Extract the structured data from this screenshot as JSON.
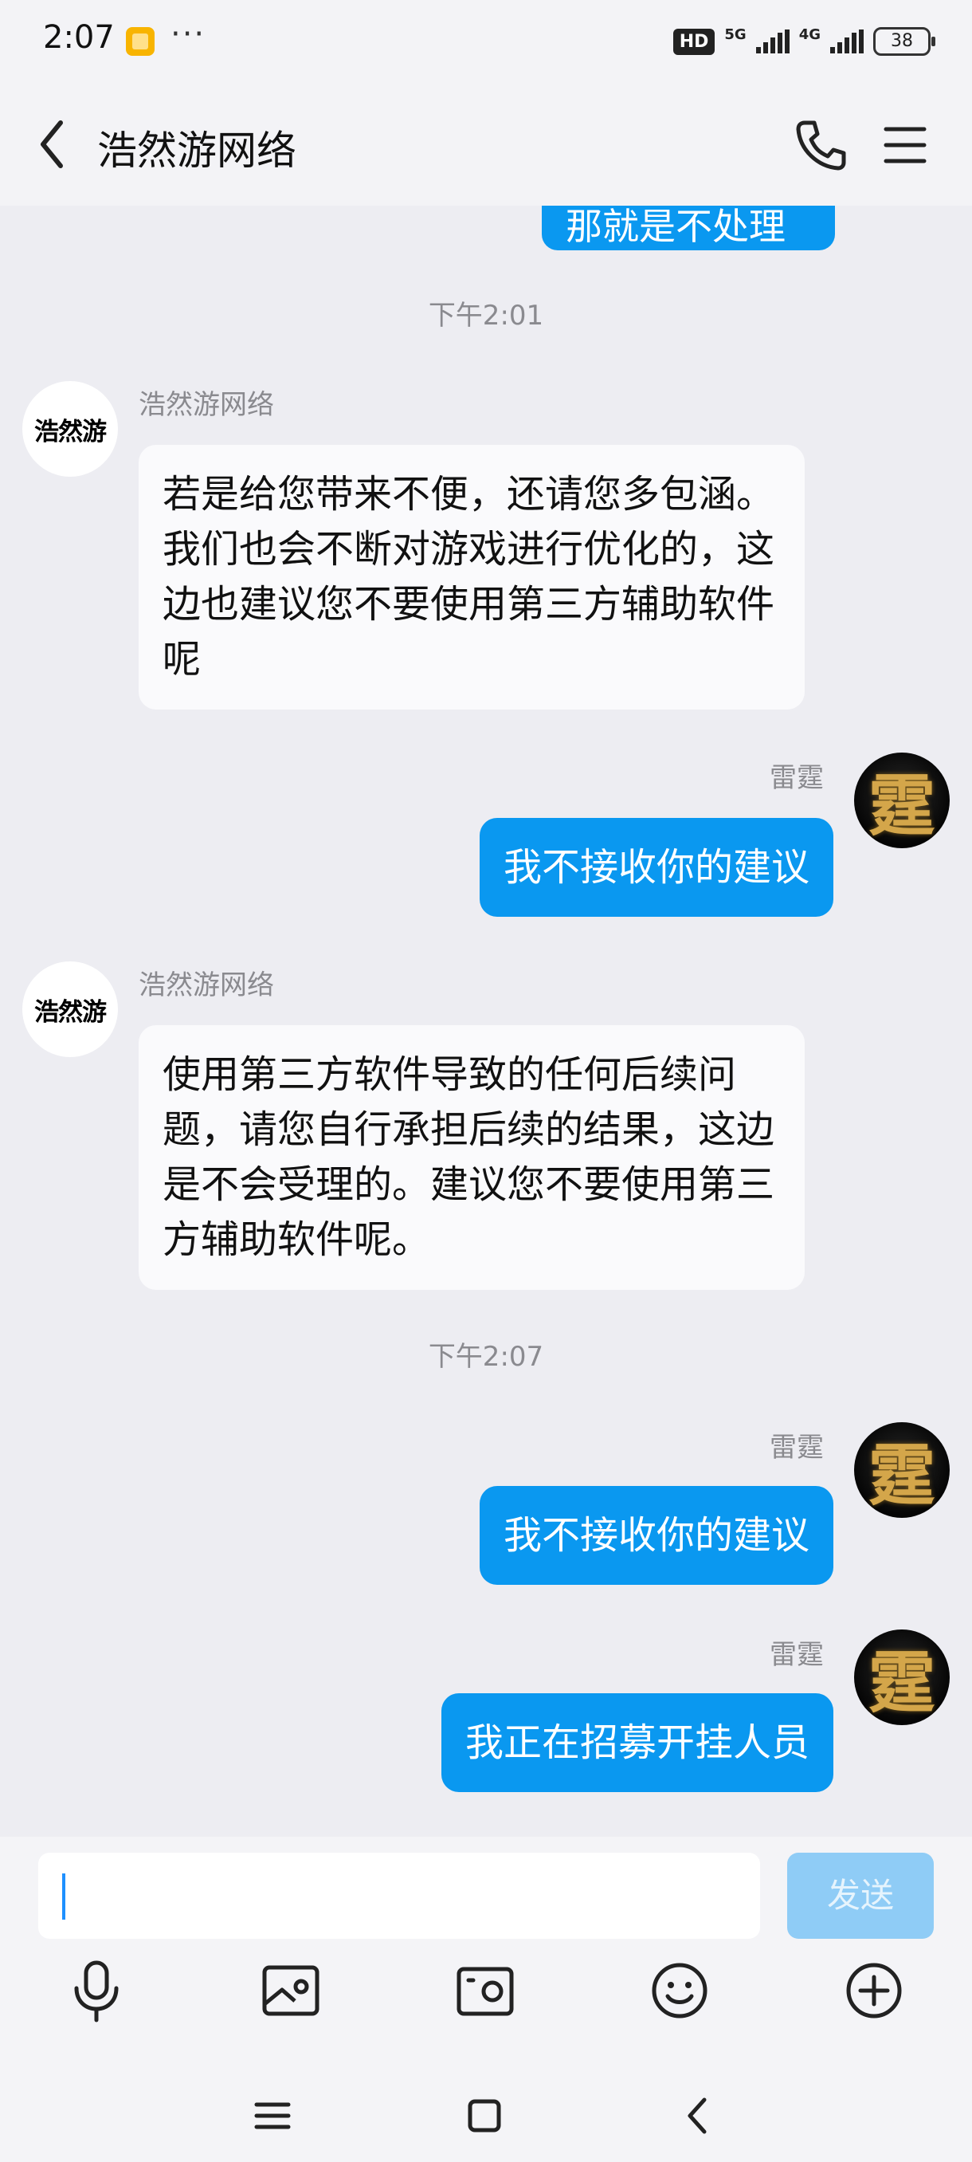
{
  "status_bar": {
    "time": "2:07",
    "more": "···",
    "hd_label": "HD",
    "net_1": "5G",
    "net_2": "4G",
    "battery": "38"
  },
  "header": {
    "title": "浩然游网络"
  },
  "messages": {
    "partial_text": "那就是不处理",
    "sep_1": "下午2:01",
    "company_avatar_text": "浩然游",
    "user_avatar_text": "霆",
    "m1_sender": "浩然游网络",
    "m1_text": "若是给您带来不便，还请您多包涵。我们也会不断对游戏进行优化的，这边也建议您不要使用第三方辅助软件呢",
    "m2_sender": "雷霆",
    "m2_text": "我不接收你的建议",
    "m3_sender": "浩然游网络",
    "m3_text": "使用第三方软件导致的任何后续问题，请您自行承担后续的结果，这边是不会受理的。建议您不要使用第三方辅助软件呢。",
    "sep_2": "下午2:07",
    "m4_sender": "雷霆",
    "m4_text": "我不接收你的建议",
    "m5_sender": "雷霆",
    "m5_text": "我正在招募开挂人员"
  },
  "input": {
    "value": "",
    "send_label": "发送"
  },
  "toolbar": {
    "icons": [
      "microphone-icon",
      "image-icon",
      "camera-icon",
      "emoji-icon",
      "plus-icon"
    ]
  },
  "colors": {
    "accent": "#0a98f0",
    "send_disabled": "#8fccf6",
    "background": "#ededf2"
  }
}
